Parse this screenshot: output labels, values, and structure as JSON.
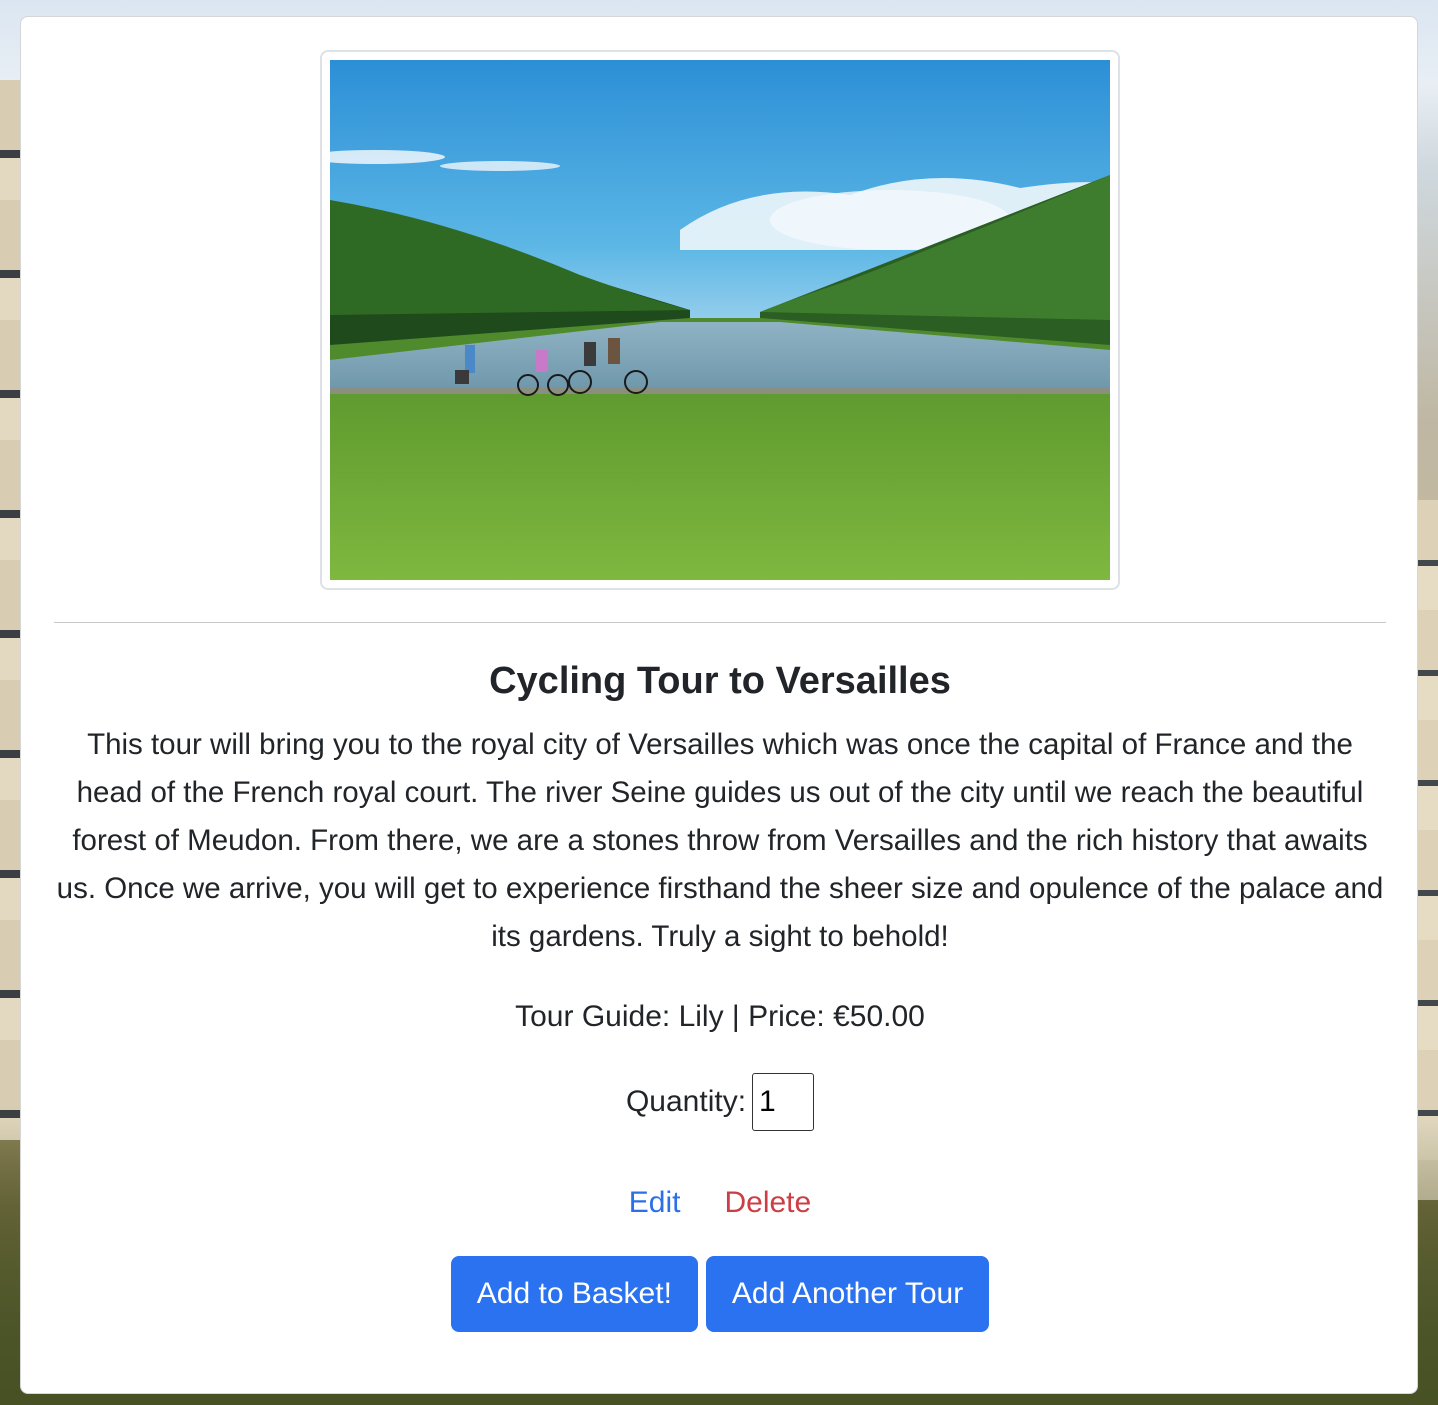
{
  "tour": {
    "image_alt": "Cyclists riding along the Grand Canal in the gardens of Versailles",
    "title": "Cycling Tour to Versailles",
    "description": "This tour will bring you to the royal city of Versailles which was once the capital of France and the head of the French royal court. The river Seine guides us out of the city until we reach the beautiful forest of Meudon. From there, we are a stones throw from Versailles and the rich history that awaits us. Once we arrive, you will get to experience firsthand the sheer size and opulence of the palace and its gardens. Truly a sight to behold!",
    "guide_label": "Tour Guide:",
    "guide_name": "Lily",
    "separator": "|",
    "price_label": "Price:",
    "price": "€50.00"
  },
  "quantity": {
    "label": "Quantity:",
    "value": "1"
  },
  "actions": {
    "edit_label": "Edit",
    "delete_label": "Delete",
    "add_to_basket_label": "Add to Basket!",
    "add_another_label": "Add Another Tour"
  },
  "colors": {
    "primary": "#2a72ef",
    "edit_link": "#2b70e8",
    "delete_link": "#cc3d45",
    "text": "#212529"
  }
}
